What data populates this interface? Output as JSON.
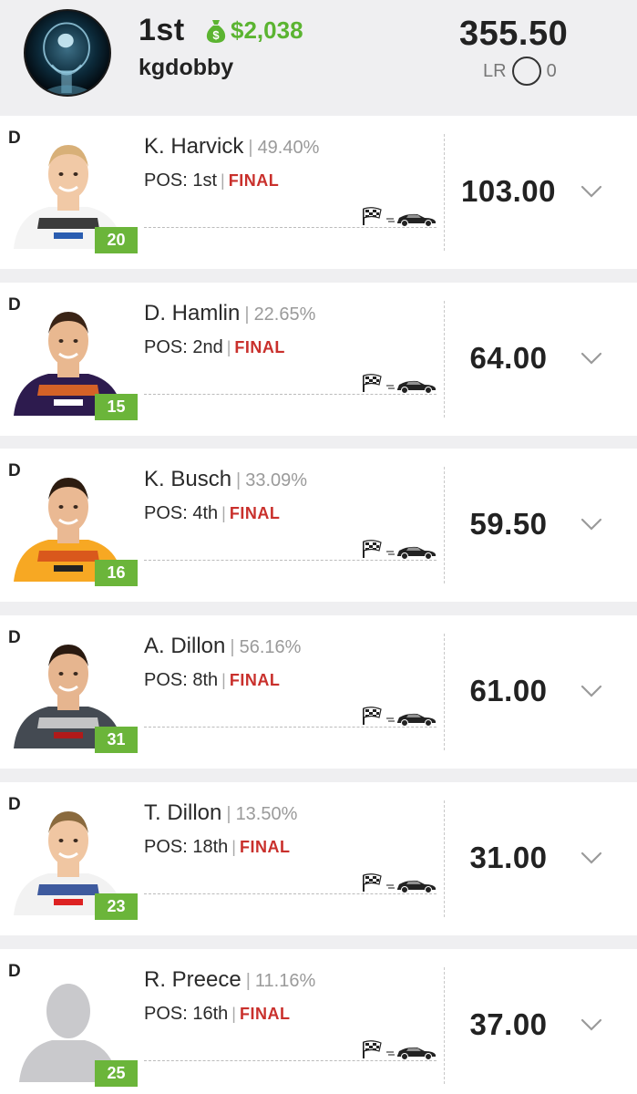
{
  "header": {
    "rank": "1st",
    "prize": "$2,038",
    "username": "kgdobby",
    "total_points": "355.50",
    "lr_label": "LR",
    "lr_value": "0"
  },
  "colors": {
    "prize_green": "#5bb431",
    "badge_green": "#6bb53a",
    "final_red": "#c9302c",
    "page_bg": "#efeff1"
  },
  "drivers": [
    {
      "slot": "D",
      "name": "K. Harvick",
      "ownership": "49.40%",
      "position": "POS: 1st",
      "status": "FINAL",
      "car_number": "20",
      "points": "103.00",
      "suit": "harvick"
    },
    {
      "slot": "D",
      "name": "D. Hamlin",
      "ownership": "22.65%",
      "position": "POS: 2nd",
      "status": "FINAL",
      "car_number": "15",
      "points": "64.00",
      "suit": "hamlin"
    },
    {
      "slot": "D",
      "name": "K. Busch",
      "ownership": "33.09%",
      "position": "POS: 4th",
      "status": "FINAL",
      "car_number": "16",
      "points": "59.50",
      "suit": "busch"
    },
    {
      "slot": "D",
      "name": "A. Dillon",
      "ownership": "56.16%",
      "position": "POS: 8th",
      "status": "FINAL",
      "car_number": "31",
      "points": "61.00",
      "suit": "adillon"
    },
    {
      "slot": "D",
      "name": "T. Dillon",
      "ownership": "13.50%",
      "position": "POS: 18th",
      "status": "FINAL",
      "car_number": "23",
      "points": "31.00",
      "suit": "tdillon"
    },
    {
      "slot": "D",
      "name": "R. Preece",
      "ownership": "11.16%",
      "position": "POS: 16th",
      "status": "FINAL",
      "car_number": "25",
      "points": "37.00",
      "suit": "placeholder"
    }
  ],
  "icons": {
    "prize": "money-bag-icon",
    "expand": "chevron-down-icon",
    "finish": "checkered-flag-icon",
    "car": "race-car-icon"
  }
}
